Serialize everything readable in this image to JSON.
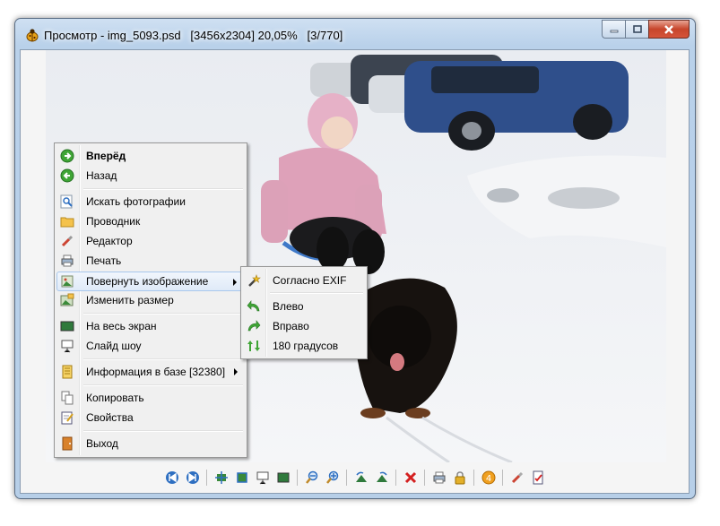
{
  "window": {
    "title": "Просмотр - img_5093.psd   [3456x2304] 20,05%   [3/770]",
    "app_icon": "ladybug-icon",
    "caption_buttons": [
      "minimize-icon",
      "maximize-icon",
      "close-icon"
    ]
  },
  "context_menu": {
    "items": [
      {
        "label": "Вперёд",
        "icon": "forward-green-icon",
        "bold": true
      },
      {
        "label": "Назад",
        "icon": "back-green-icon"
      },
      {
        "label": "Искать фотографии",
        "icon": "search-photos-icon"
      },
      {
        "label": "Проводник",
        "icon": "folder-icon"
      },
      {
        "label": "Редактор",
        "icon": "editor-brush-icon"
      },
      {
        "label": "Печать",
        "icon": "printer-icon"
      },
      {
        "label": "Повернуть изображение",
        "icon": "rotate-image-icon",
        "submenu": true,
        "highlighted": true
      },
      {
        "label": "Изменить размер",
        "icon": "resize-icon"
      },
      {
        "label": "На весь экран",
        "icon": "fullscreen-icon"
      },
      {
        "label": "Слайд шоу",
        "icon": "slideshow-icon"
      },
      {
        "label": "Информация в базе [32380]",
        "icon": "database-info-icon",
        "submenu": true
      },
      {
        "label": "Копировать",
        "icon": "copy-icon"
      },
      {
        "label": "Свойства",
        "icon": "properties-icon"
      },
      {
        "label": "Выход",
        "icon": "exit-icon"
      }
    ]
  },
  "rotate_submenu": {
    "items": [
      {
        "label": "Согласно EXIF",
        "icon": "magic-wand-icon"
      },
      {
        "label": "Влево",
        "icon": "rotate-left-icon"
      },
      {
        "label": "Вправо",
        "icon": "rotate-right-icon"
      },
      {
        "label": "180 градусов",
        "icon": "rotate-180-icon"
      }
    ]
  },
  "toolbar": {
    "buttons": [
      "previous-icon",
      "next-icon",
      "fit-window-icon",
      "actual-size-icon",
      "slideshow-icon",
      "fullscreen-icon",
      "zoom-out-icon",
      "zoom-in-icon",
      "rotate-left-icon",
      "rotate-right-icon",
      "delete-icon",
      "print-icon",
      "lock-icon",
      "info-icon",
      "editor-icon",
      "properties-icon"
    ]
  },
  "colors": {
    "accent_blue": "#2e6fc1",
    "green_nav": "#3fa535",
    "delete_red": "#d42020",
    "menu_highlight_border": "#a8c7ec"
  }
}
